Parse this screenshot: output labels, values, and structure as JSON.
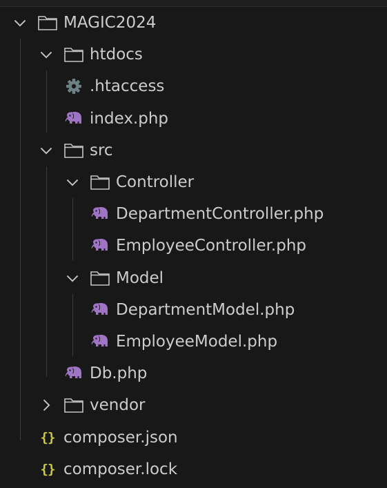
{
  "colors": {
    "background": "#181818",
    "text": "#cccccc",
    "folder_icon": "#c5c5c5",
    "php_icon": "#a074c4",
    "gear_icon": "#6d8086",
    "json_icon": "#cbcb41"
  },
  "tree": {
    "root": {
      "label": "MAGIC2024",
      "state": "expanded"
    },
    "htdocs": {
      "label": "htdocs",
      "state": "expanded"
    },
    "htaccess": {
      "label": ".htaccess",
      "icon": "gear-icon"
    },
    "index": {
      "label": "index.php",
      "icon": "php-elephant-icon"
    },
    "src": {
      "label": "src",
      "state": "expanded"
    },
    "controller": {
      "label": "Controller",
      "state": "expanded"
    },
    "department_controller": {
      "label": "DepartmentController.php",
      "icon": "php-elephant-icon"
    },
    "employee_controller": {
      "label": "EmployeeController.php",
      "icon": "php-elephant-icon"
    },
    "model": {
      "label": "Model",
      "state": "expanded"
    },
    "department_model": {
      "label": "DepartmentModel.php",
      "icon": "php-elephant-icon"
    },
    "employee_model": {
      "label": "EmployeeModel.php",
      "icon": "php-elephant-icon"
    },
    "db": {
      "label": "Db.php",
      "icon": "php-elephant-icon"
    },
    "vendor": {
      "label": "vendor",
      "state": "collapsed"
    },
    "composer_json": {
      "label": "composer.json",
      "icon": "json-braces-icon",
      "glyph": "{}"
    },
    "composer_lock": {
      "label": "composer.lock",
      "icon": "json-braces-icon",
      "glyph": "{}"
    }
  }
}
